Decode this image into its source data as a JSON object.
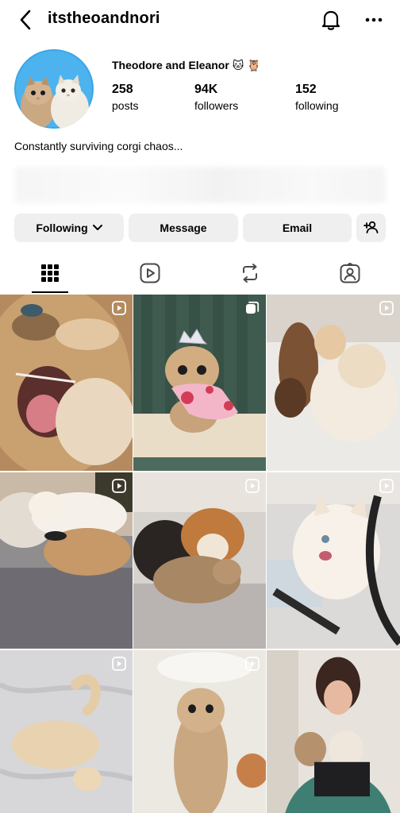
{
  "header": {
    "username": "itstheoandnori",
    "icons": [
      "back-arrow-icon",
      "bell-icon",
      "more-icon"
    ]
  },
  "profile": {
    "display_name": "Theodore and Eleanor 🐱 🦉",
    "posts_count": "258",
    "posts_label": "posts",
    "followers_count": "94K",
    "followers_label": "followers",
    "following_count": "152",
    "following_label": "following",
    "bio": "Constantly surviving corgi chaos..."
  },
  "actions": {
    "following_label": "Following",
    "message_label": "Message",
    "email_label": "Email",
    "add_user_icon": "add-user-icon"
  },
  "tabs": [
    "grid-icon",
    "reels-icon",
    "reposts-icon",
    "tagged-icon"
  ],
  "grid": {
    "posts": [
      {
        "subject": "cat yawning close-up",
        "badge": "reel-icon"
      },
      {
        "subject": "cat wearing crown and heart dress",
        "badge": "carousel-icon"
      },
      {
        "subject": "two cats wrestling",
        "badge": "reel-icon"
      },
      {
        "subject": "two cats cuddling on bed",
        "badge": "reel-icon"
      },
      {
        "subject": "corgi and cat on bed",
        "badge": "reel-icon"
      },
      {
        "subject": "white cat in chair",
        "badge": "reel-icon"
      },
      {
        "subject": "cat lying on blanket",
        "badge": "reel-icon"
      },
      {
        "subject": "cat standing upright",
        "badge": "reel-icon"
      },
      {
        "subject": "woman holding two cats",
        "badge": "reel-icon"
      }
    ]
  },
  "colors": {
    "button_bg": "#efefef",
    "text": "#000000",
    "avatar_ring": "#3aa6e6"
  }
}
